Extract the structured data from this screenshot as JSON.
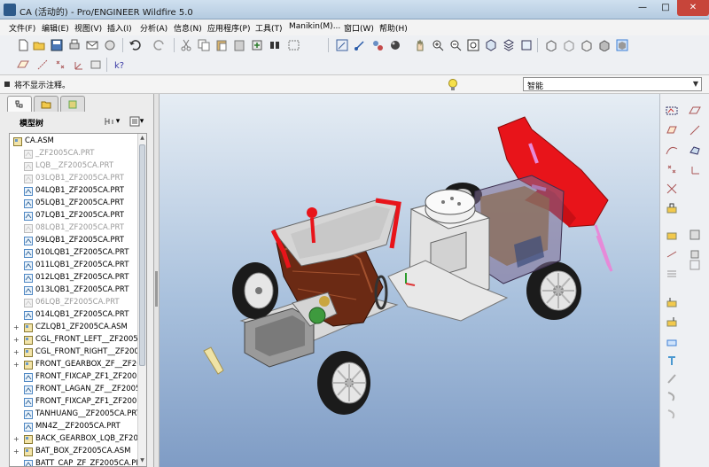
{
  "window": {
    "title": "CA (活动的) - Pro/ENGINEER Wildfire 5.0",
    "min": "—",
    "max": "□",
    "close": "✕"
  },
  "menu": [
    "文件(F)",
    "编辑(E)",
    "视图(V)",
    "插入(I)",
    "分析(A)",
    "信息(N)",
    "应用程序(P)",
    "工具(T)",
    "Manikin(M)...",
    "窗口(W)",
    "帮助(H)"
  ],
  "message": "将不显示注释。",
  "filter": {
    "value": "智能"
  },
  "model_tree": {
    "header": "模型树",
    "rows": [
      {
        "label": "CA.ASM",
        "kind": "asm",
        "expand": "",
        "dim": false
      },
      {
        "label": "_ZF2005CA.PRT",
        "kind": "prt",
        "expand": "",
        "dim": true
      },
      {
        "label": "LQB__ZF2005CA.PRT",
        "kind": "prt",
        "expand": "",
        "dim": true
      },
      {
        "label": "03LQB1_ZF2005CA.PRT",
        "kind": "prt",
        "expand": "",
        "dim": true
      },
      {
        "label": "04LQB1_ZF2005CA.PRT",
        "kind": "prt",
        "expand": "",
        "dim": false
      },
      {
        "label": "05LQB1_ZF2005CA.PRT",
        "kind": "prt",
        "expand": "",
        "dim": false
      },
      {
        "label": "07LQB1_ZF2005CA.PRT",
        "kind": "prt",
        "expand": "",
        "dim": false
      },
      {
        "label": "08LQB1_ZF2005CA.PRT",
        "kind": "prt",
        "expand": "",
        "dim": true
      },
      {
        "label": "09LQB1_ZF2005CA.PRT",
        "kind": "prt",
        "expand": "",
        "dim": false
      },
      {
        "label": "010LQB1_ZF2005CA.PRT",
        "kind": "prt",
        "expand": "",
        "dim": false
      },
      {
        "label": "011LQB1_ZF2005CA.PRT",
        "kind": "prt",
        "expand": "",
        "dim": false
      },
      {
        "label": "012LQB1_ZF2005CA.PRT",
        "kind": "prt",
        "expand": "",
        "dim": false
      },
      {
        "label": "013LQB1_ZF2005CA.PRT",
        "kind": "prt",
        "expand": "",
        "dim": false
      },
      {
        "label": "06LQB_ZF2005CA.PRT",
        "kind": "prt",
        "expand": "",
        "dim": true
      },
      {
        "label": "014LQB1_ZF2005CA.PRT",
        "kind": "prt",
        "expand": "",
        "dim": false
      },
      {
        "label": "CZLQB1_ZF2005CA.ASM",
        "kind": "asm",
        "expand": "+",
        "dim": false
      },
      {
        "label": "CGL_FRONT_LEFT__ZF2005",
        "kind": "asm",
        "expand": "+",
        "dim": false
      },
      {
        "label": "CGL_FRONT_RIGHT__ZF200",
        "kind": "asm",
        "expand": "+",
        "dim": false
      },
      {
        "label": "FRONT_GEARBOX_ZF__ZF20",
        "kind": "asm",
        "expand": "+",
        "dim": false
      },
      {
        "label": "FRONT_FIXCAP_ZF1_ZF2005",
        "kind": "prt",
        "expand": "",
        "dim": false
      },
      {
        "label": "FRONT_LAGAN_ZF__ZF2005",
        "kind": "prt",
        "expand": "",
        "dim": false
      },
      {
        "label": "FRONT_FIXCAP_ZF1_ZF2005",
        "kind": "prt",
        "expand": "",
        "dim": false
      },
      {
        "label": "TANHUANG__ZF2005CA.PRT",
        "kind": "prt",
        "expand": "",
        "dim": false
      },
      {
        "label": "MN4Z__ZF2005CA.PRT",
        "kind": "prt",
        "expand": "",
        "dim": false
      },
      {
        "label": "BACK_GEARBOX_LQB_ZF200",
        "kind": "asm",
        "expand": "+",
        "dim": false
      },
      {
        "label": "BAT_BOX_ZF2005CA.ASM",
        "kind": "asm",
        "expand": "+",
        "dim": false
      },
      {
        "label": "BATT_CAP_ZF_ZF2005CA.PRT",
        "kind": "prt",
        "expand": "",
        "dim": false
      }
    ]
  },
  "toolbar1_icons": [
    "new-icon",
    "open-icon",
    "save-icon",
    "print-icon",
    "send-icon",
    "close-window-icon",
    "undo-icon",
    "redo-icon",
    "cut-icon",
    "copy-icon",
    "paste-icon",
    "paste-special-icon",
    "regenerate-icon",
    "find-icon",
    "select-box-icon",
    "repaint-icon",
    "spin-center-icon",
    "orient-icon",
    "appearance-icon",
    "zoom-in-icon",
    "zoom-out-icon",
    "refit-icon",
    "reorient-icon",
    "view-manager-icon",
    "saved-views-icon",
    "wireframe-icon",
    "hidden-line-icon",
    "no-hidden-icon",
    "shading-icon"
  ],
  "toolbar2_icons": [
    "datum-planes-icon",
    "datum-axes-icon",
    "datum-points-icon",
    "coord-sys-icon",
    "context-help-icon"
  ],
  "right_icons": [
    "sketch-icon",
    "plane-icon",
    "axis-icon",
    "curve-icon",
    "point-icon",
    "csys-icon",
    "analysis-icon",
    "assemble-icon",
    "create-icon",
    "package-icon",
    "mirror-icon",
    "explode-icon",
    "pattern-icon",
    "round-icon",
    "chamfer-icon",
    "hole-icon",
    "cut-icon"
  ],
  "colors": {
    "viewport_top": "#e6edf4",
    "viewport_bottom": "#7f9cc5",
    "spoiler": "#e8141a",
    "chassis": "#dcdcdc"
  }
}
